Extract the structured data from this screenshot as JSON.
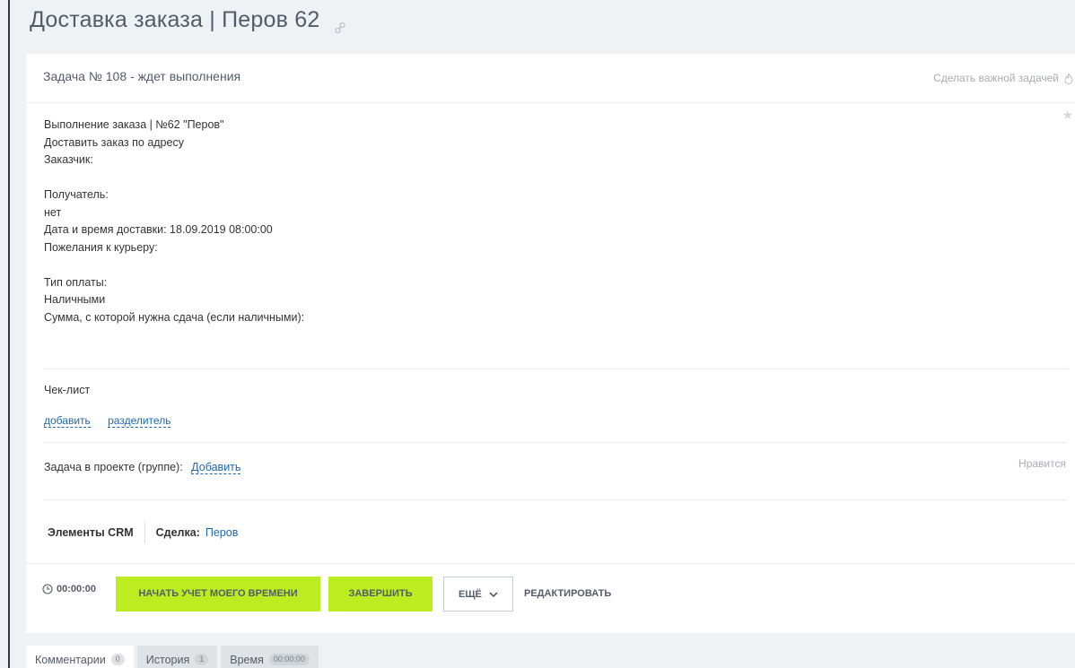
{
  "page": {
    "title": "Доставка заказа | Перов 62",
    "link_icon": "link-icon"
  },
  "task": {
    "status_text": "Задача № 108 - ждет выполнения",
    "make_important_label": "Сделать важной задачей",
    "important_icon": "flame-icon",
    "favorite_icon": "star-icon"
  },
  "description": {
    "lines": [
      "Выполнение заказа | №62  \"Перов\"",
      "Доставить заказ по адресу",
      "Заказчик:",
      "",
      "Получатель:",
      "нет",
      "Дата и время доставки: 18.09.2019 08:00:00",
      "Пожелания к курьеру:",
      "",
      "Тип оплаты:",
      "Наличными",
      "Сумма, с которой нужна сдача (если наличными):"
    ]
  },
  "checklist": {
    "title": "Чек-лист",
    "add_label": "добавить",
    "separator_label": "разделитель"
  },
  "project": {
    "label": "Задача в проекте (группе):",
    "add_label": "Добавить",
    "likes_label": "Нравится"
  },
  "crm": {
    "elements_label": "Элементы CRM",
    "deal_label": "Сделка:",
    "deal_value": "Перов"
  },
  "actions": {
    "timer_value": "00:00:00",
    "start_time_label": "НАЧАТЬ УЧЕТ МОЕГО ВРЕМЕНИ",
    "finish_label": "ЗАВЕРШИТЬ",
    "more_label": "ЕЩЁ",
    "edit_label": "РЕДАКТИРОВАТЬ"
  },
  "tabs": [
    {
      "label": "Комментарии",
      "count": "0"
    },
    {
      "label": "История",
      "count": "1"
    },
    {
      "label": "Время",
      "count": "00:00:00"
    }
  ],
  "colors": {
    "accent_green": "#bbed21",
    "link_blue": "#2067b0",
    "background": "#eef2f4"
  }
}
